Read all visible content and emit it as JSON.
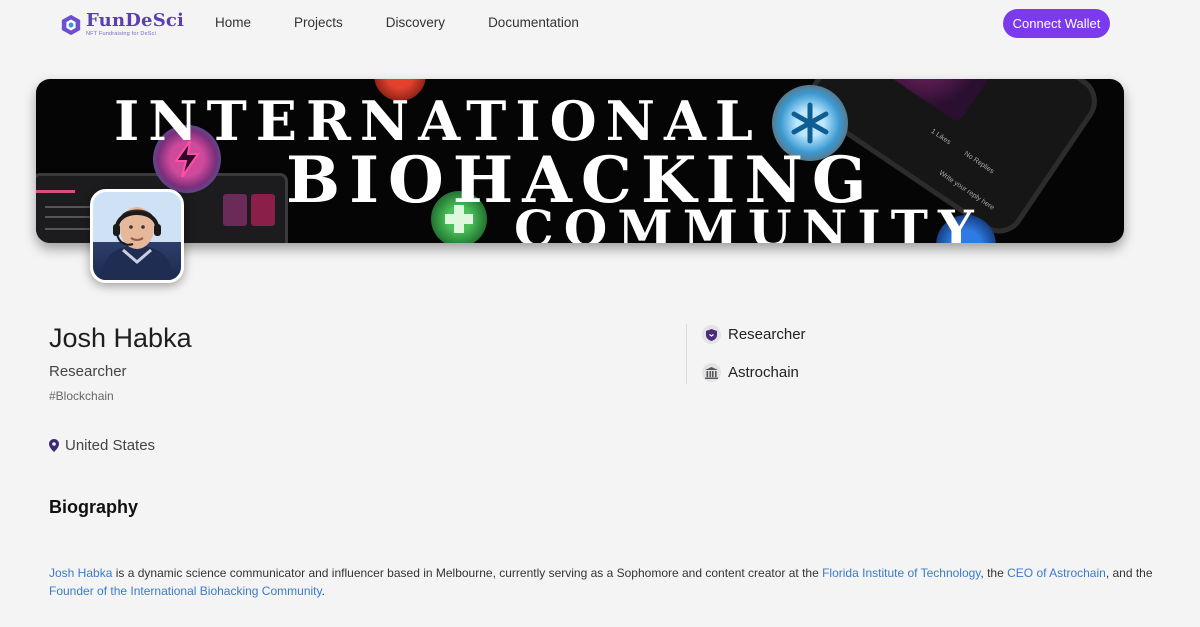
{
  "header": {
    "logo_name": "FunDeSci",
    "logo_tagline": "NFT Fundraising for DeSci",
    "nav": [
      "Home",
      "Projects",
      "Discovery",
      "Documentation"
    ],
    "connect_label": "Connect Wallet",
    "accent": "#7c3aed"
  },
  "banner": {
    "line1": "INTERNATIONAL",
    "line2": "BIOHACKING",
    "line3": "COMMUNITY",
    "phone_likes": "1 Likes",
    "phone_replies": "No Replies",
    "phone_reply_placeholder": "Write your reply here"
  },
  "profile": {
    "name": "Josh Habka",
    "role": "Researcher",
    "tag": "#Blockchain",
    "location": "United States",
    "meta": [
      {
        "icon": "shield-icon",
        "label": "Researcher"
      },
      {
        "icon": "institution-icon",
        "label": "Astrochain"
      }
    ]
  },
  "biography": {
    "title": "Biography",
    "parts": [
      {
        "text": "Josh Habka",
        "link": true
      },
      {
        "text": " is a dynamic science communicator and influencer based in Melbourne, currently serving as a Sophomore and content creator at the ",
        "link": false
      },
      {
        "text": "Florida Institute of Technology",
        "link": true
      },
      {
        "text": ", the ",
        "link": false
      },
      {
        "text": "CEO of Astrochain",
        "link": true
      },
      {
        "text": ", and the ",
        "link": false
      },
      {
        "text": "Founder of the International Biohacking Community",
        "link": true
      },
      {
        "text": ".",
        "link": false
      }
    ]
  }
}
